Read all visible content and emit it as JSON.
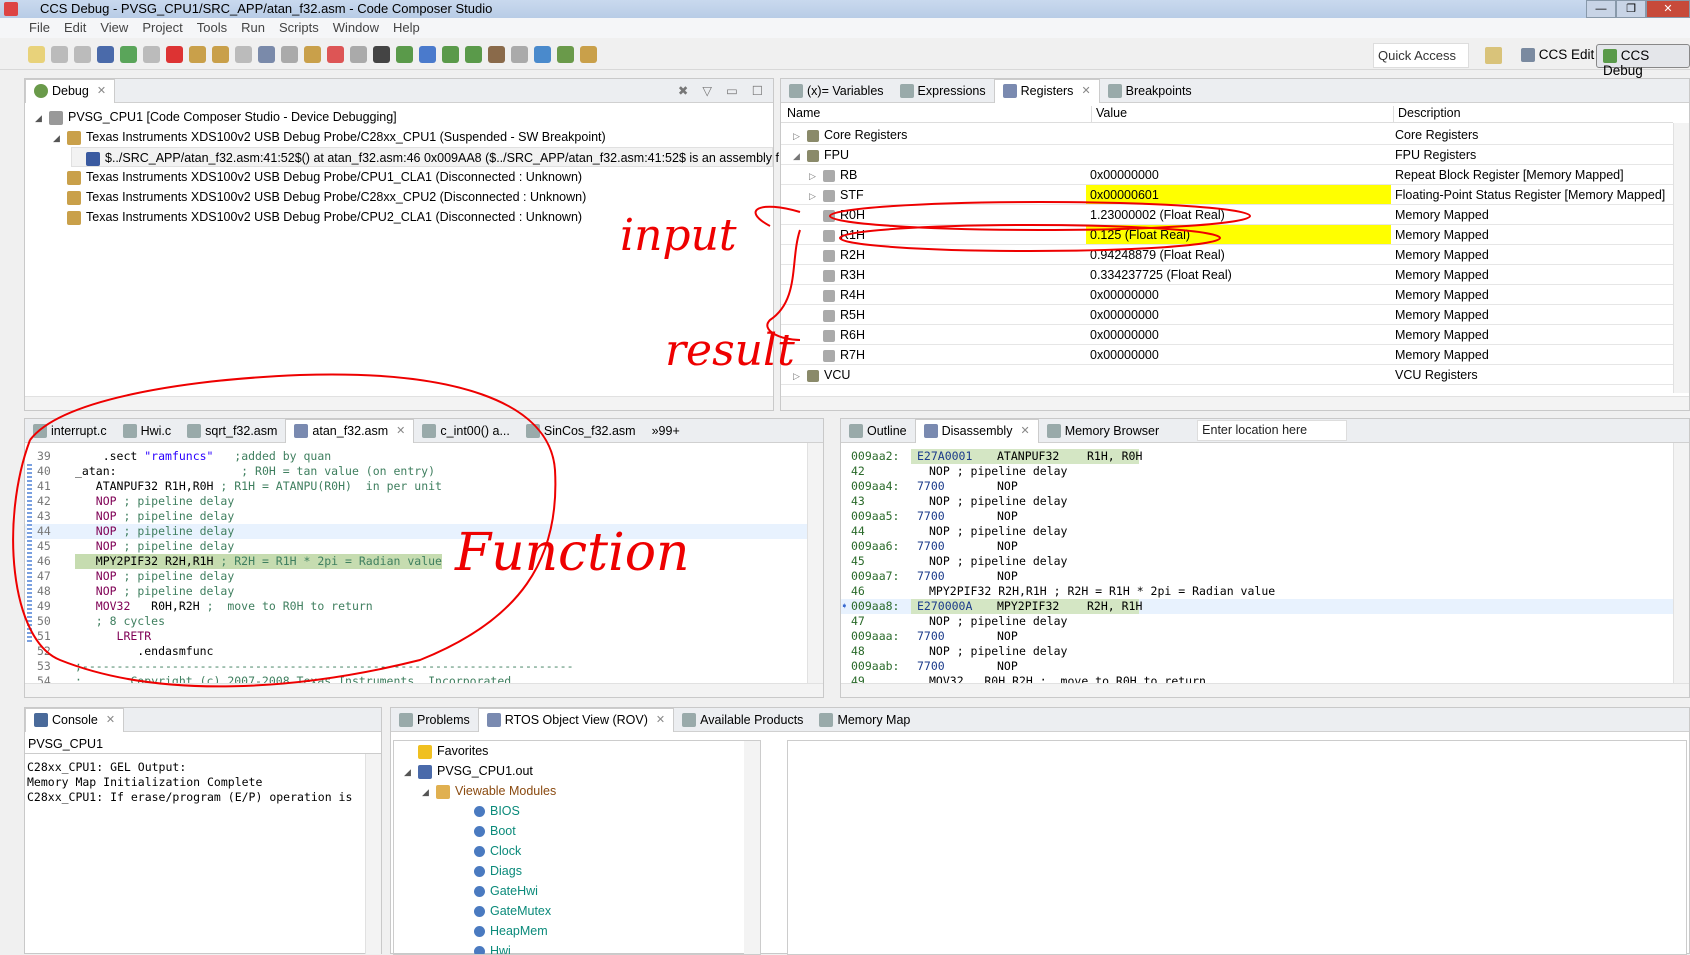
{
  "window": {
    "title": "CCS Debug - PVSG_CPU1/SRC_APP/atan_f32.asm - Code Composer Studio",
    "controls": [
      "—",
      "❐",
      "✕"
    ]
  },
  "menu": [
    "File",
    "Edit",
    "View",
    "Project",
    "Tools",
    "Run",
    "Scripts",
    "Window",
    "Help"
  ],
  "toolbar": {
    "quick_access": "Quick Access",
    "perspectives": [
      "CCS Edit",
      "CCS Debug"
    ]
  },
  "debug": {
    "tab": "Debug",
    "tree": [
      {
        "level": 0,
        "text": "PVSG_CPU1 [Code Composer Studio - Device Debugging]",
        "icon": "device-icon"
      },
      {
        "level": 1,
        "text": "Texas Instruments XDS100v2 USB Debug Probe/C28xx_CPU1 (Suspended - SW Breakpoint)",
        "icon": "suspended-thread-icon"
      },
      {
        "level": 2,
        "text": "$../SRC_APP/atan_f32.asm:41:52$() at atan_f32.asm:46 0x009AA8  ($../SRC_APP/atan_f32.asm:41:52$ is an assembly f",
        "icon": "stack-frame-icon"
      },
      {
        "level": 1,
        "text": "Texas Instruments XDS100v2 USB Debug Probe/CPU1_CLA1 (Disconnected : Unknown)",
        "icon": "disconnected-icon"
      },
      {
        "level": 1,
        "text": "Texas Instruments XDS100v2 USB Debug Probe/C28xx_CPU2 (Disconnected : Unknown)",
        "icon": "disconnected-icon"
      },
      {
        "level": 1,
        "text": "Texas Instruments XDS100v2 USB Debug Probe/CPU2_CLA1 (Disconnected : Unknown)",
        "icon": "disconnected-icon"
      }
    ]
  },
  "registers": {
    "tabs": [
      "(x)= Variables",
      "Expressions",
      "Registers",
      "Breakpoints"
    ],
    "active_tab": 2,
    "columns": [
      "Name",
      "Value",
      "Description"
    ],
    "rows": [
      {
        "level": 0,
        "name": "Core Registers",
        "value": "",
        "desc": "Core Registers",
        "expand": "▷"
      },
      {
        "level": 0,
        "name": "FPU",
        "value": "",
        "desc": "FPU Registers",
        "expand": "◢"
      },
      {
        "level": 1,
        "name": "RB",
        "value": "0x00000000",
        "desc": "Repeat Block Register [Memory Mapped]",
        "expand": "▷"
      },
      {
        "level": 1,
        "name": "STF",
        "value": "0x00000601",
        "desc": "Floating-Point Status Register [Memory Mapped]",
        "expand": "▷",
        "changed": true
      },
      {
        "level": 1,
        "name": "R0H",
        "value": "1.23000002 (Float Real)",
        "desc": "Memory Mapped"
      },
      {
        "level": 1,
        "name": "R1H",
        "value": "0.125 (Float Real)",
        "desc": "Memory Mapped",
        "changed": true
      },
      {
        "level": 1,
        "name": "R2H",
        "value": "0.94248879 (Float Real)",
        "desc": "Memory Mapped"
      },
      {
        "level": 1,
        "name": "R3H",
        "value": "0.334237725 (Float Real)",
        "desc": "Memory Mapped"
      },
      {
        "level": 1,
        "name": "R4H",
        "value": "0x00000000",
        "desc": "Memory Mapped"
      },
      {
        "level": 1,
        "name": "R5H",
        "value": "0x00000000",
        "desc": "Memory Mapped"
      },
      {
        "level": 1,
        "name": "R6H",
        "value": "0x00000000",
        "desc": "Memory Mapped"
      },
      {
        "level": 1,
        "name": "R7H",
        "value": "0x00000000",
        "desc": "Memory Mapped"
      },
      {
        "level": 0,
        "name": "VCU",
        "value": "",
        "desc": "VCU Registers",
        "expand": "▷"
      }
    ],
    "changed_color": "#ffff00"
  },
  "editor": {
    "tabs": [
      "interrupt.c",
      "Hwi.c",
      "sqrt_f32.asm",
      "atan_f32.asm",
      "c_int00() a...",
      "SinCos_f32.asm"
    ],
    "active_tab": 3,
    "overflow": "»99+",
    "lines": [
      {
        "n": "39",
        "code": "    .sect ",
        "str": "\"ramfuncs\"",
        "cm": "   ;added by quan"
      },
      {
        "n": "40",
        "code": "_atan:",
        "cm": "                  ; R0H = tan value (on entry)"
      },
      {
        "n": "41",
        "code": "   ATANPUF32 R1H,R0H ",
        "cm": "; R1H = ATANPU(R0H)  in per unit"
      },
      {
        "n": "42",
        "kw": "   NOP",
        "cm": " ; pipeline delay"
      },
      {
        "n": "43",
        "kw": "   NOP",
        "cm": " ; pipeline delay"
      },
      {
        "n": "44",
        "kw": "   NOP",
        "cm": " ; pipeline delay",
        "current": true
      },
      {
        "n": "45",
        "kw": "   NOP",
        "cm": " ; pipeline delay"
      },
      {
        "n": "46",
        "code": "   MPY2PIF32 R2H,R1H ",
        "cm": "; R2H = R1H * 2pi = Radian value",
        "pc": true
      },
      {
        "n": "47",
        "kw": "   NOP",
        "cm": " ; pipeline delay"
      },
      {
        "n": "48",
        "kw": "   NOP",
        "cm": " ; pipeline delay"
      },
      {
        "n": "49",
        "kw": "   MOV32",
        "code": "   R0H,R2H ",
        "cm": ";  move to R0H to return"
      },
      {
        "n": "50",
        "cm": "   ; 8 cycles"
      },
      {
        "n": "51",
        "kw": "      LRETR"
      },
      {
        "n": "52",
        "code": "         .endasmfunc"
      },
      {
        "n": "53",
        "cm": ";-----------------------------------------------------------------------"
      },
      {
        "n": "54",
        "cm": ";       Copyright (c) 2007-2008 Texas Instruments, Incorporated."
      }
    ]
  },
  "disassembly": {
    "tabs": [
      "Outline",
      "Disassembly",
      "Memory Browser"
    ],
    "active_tab": 1,
    "location_placeholder": "Enter location here",
    "lines": [
      {
        "addr": "009aa2:",
        "op": "E27A0001",
        "ins": "ATANPUF32    R1H, R0H",
        "hl": true
      },
      {
        "src": "42",
        "text": "NOP ; pipeline delay"
      },
      {
        "addr": "009aa4:",
        "op": "7700",
        "ins": "NOP"
      },
      {
        "src": "43",
        "text": "NOP ; pipeline delay"
      },
      {
        "addr": "009aa5:",
        "op": "7700",
        "ins": "NOP"
      },
      {
        "src": "44",
        "text": "NOP ; pipeline delay"
      },
      {
        "addr": "009aa6:",
        "op": "7700",
        "ins": "NOP"
      },
      {
        "src": "45",
        "text": "NOP ; pipeline delay"
      },
      {
        "addr": "009aa7:",
        "op": "7700",
        "ins": "NOP"
      },
      {
        "src": "46",
        "text": "MPY2PIF32 R2H,R1H ; R2H = R1H * 2pi = Radian value"
      },
      {
        "addr": "009aa8:",
        "op": "E270000A",
        "ins": "MPY2PIF32    R2H, R1H",
        "hl": true,
        "pc": true
      },
      {
        "src": "47",
        "text": "NOP ; pipeline delay"
      },
      {
        "addr": "009aaa:",
        "op": "7700",
        "ins": "NOP"
      },
      {
        "src": "48",
        "text": "NOP ; pipeline delay"
      },
      {
        "addr": "009aab:",
        "op": "7700",
        "ins": "NOP"
      },
      {
        "src": "49",
        "text": "MOV32   R0H,R2H ;  move to R0H to return"
      }
    ]
  },
  "console": {
    "tab": "Console",
    "title": "PVSG_CPU1",
    "lines": [
      "C28xx_CPU1: GEL Output:",
      "Memory Map Initialization Complete",
      "C28xx_CPU1: If erase/program (E/P) operation is"
    ]
  },
  "rov": {
    "tabs": [
      "Problems",
      "RTOS Object View (ROV)",
      "Available Products",
      "Memory Map"
    ],
    "active_tab": 1,
    "tree": [
      {
        "level": 0,
        "text": "Favorites",
        "icon": "star-icon"
      },
      {
        "level": 0,
        "text": "PVSG_CPU1.out",
        "icon": "program-icon",
        "expand": "◢"
      },
      {
        "level": 1,
        "text": "Viewable Modules",
        "icon": "folder-icon",
        "expand": "◢"
      },
      {
        "level": 2,
        "text": "BIOS"
      },
      {
        "level": 2,
        "text": "Boot"
      },
      {
        "level": 2,
        "text": "Clock"
      },
      {
        "level": 2,
        "text": "Diags"
      },
      {
        "level": 2,
        "text": "GateHwi"
      },
      {
        "level": 2,
        "text": "GateMutex"
      },
      {
        "level": 2,
        "text": "HeapMem"
      },
      {
        "level": 2,
        "text": "Hwi"
      }
    ]
  },
  "annotations": {
    "color": "#ee0000",
    "labels": [
      "input",
      "result",
      "Function"
    ]
  }
}
